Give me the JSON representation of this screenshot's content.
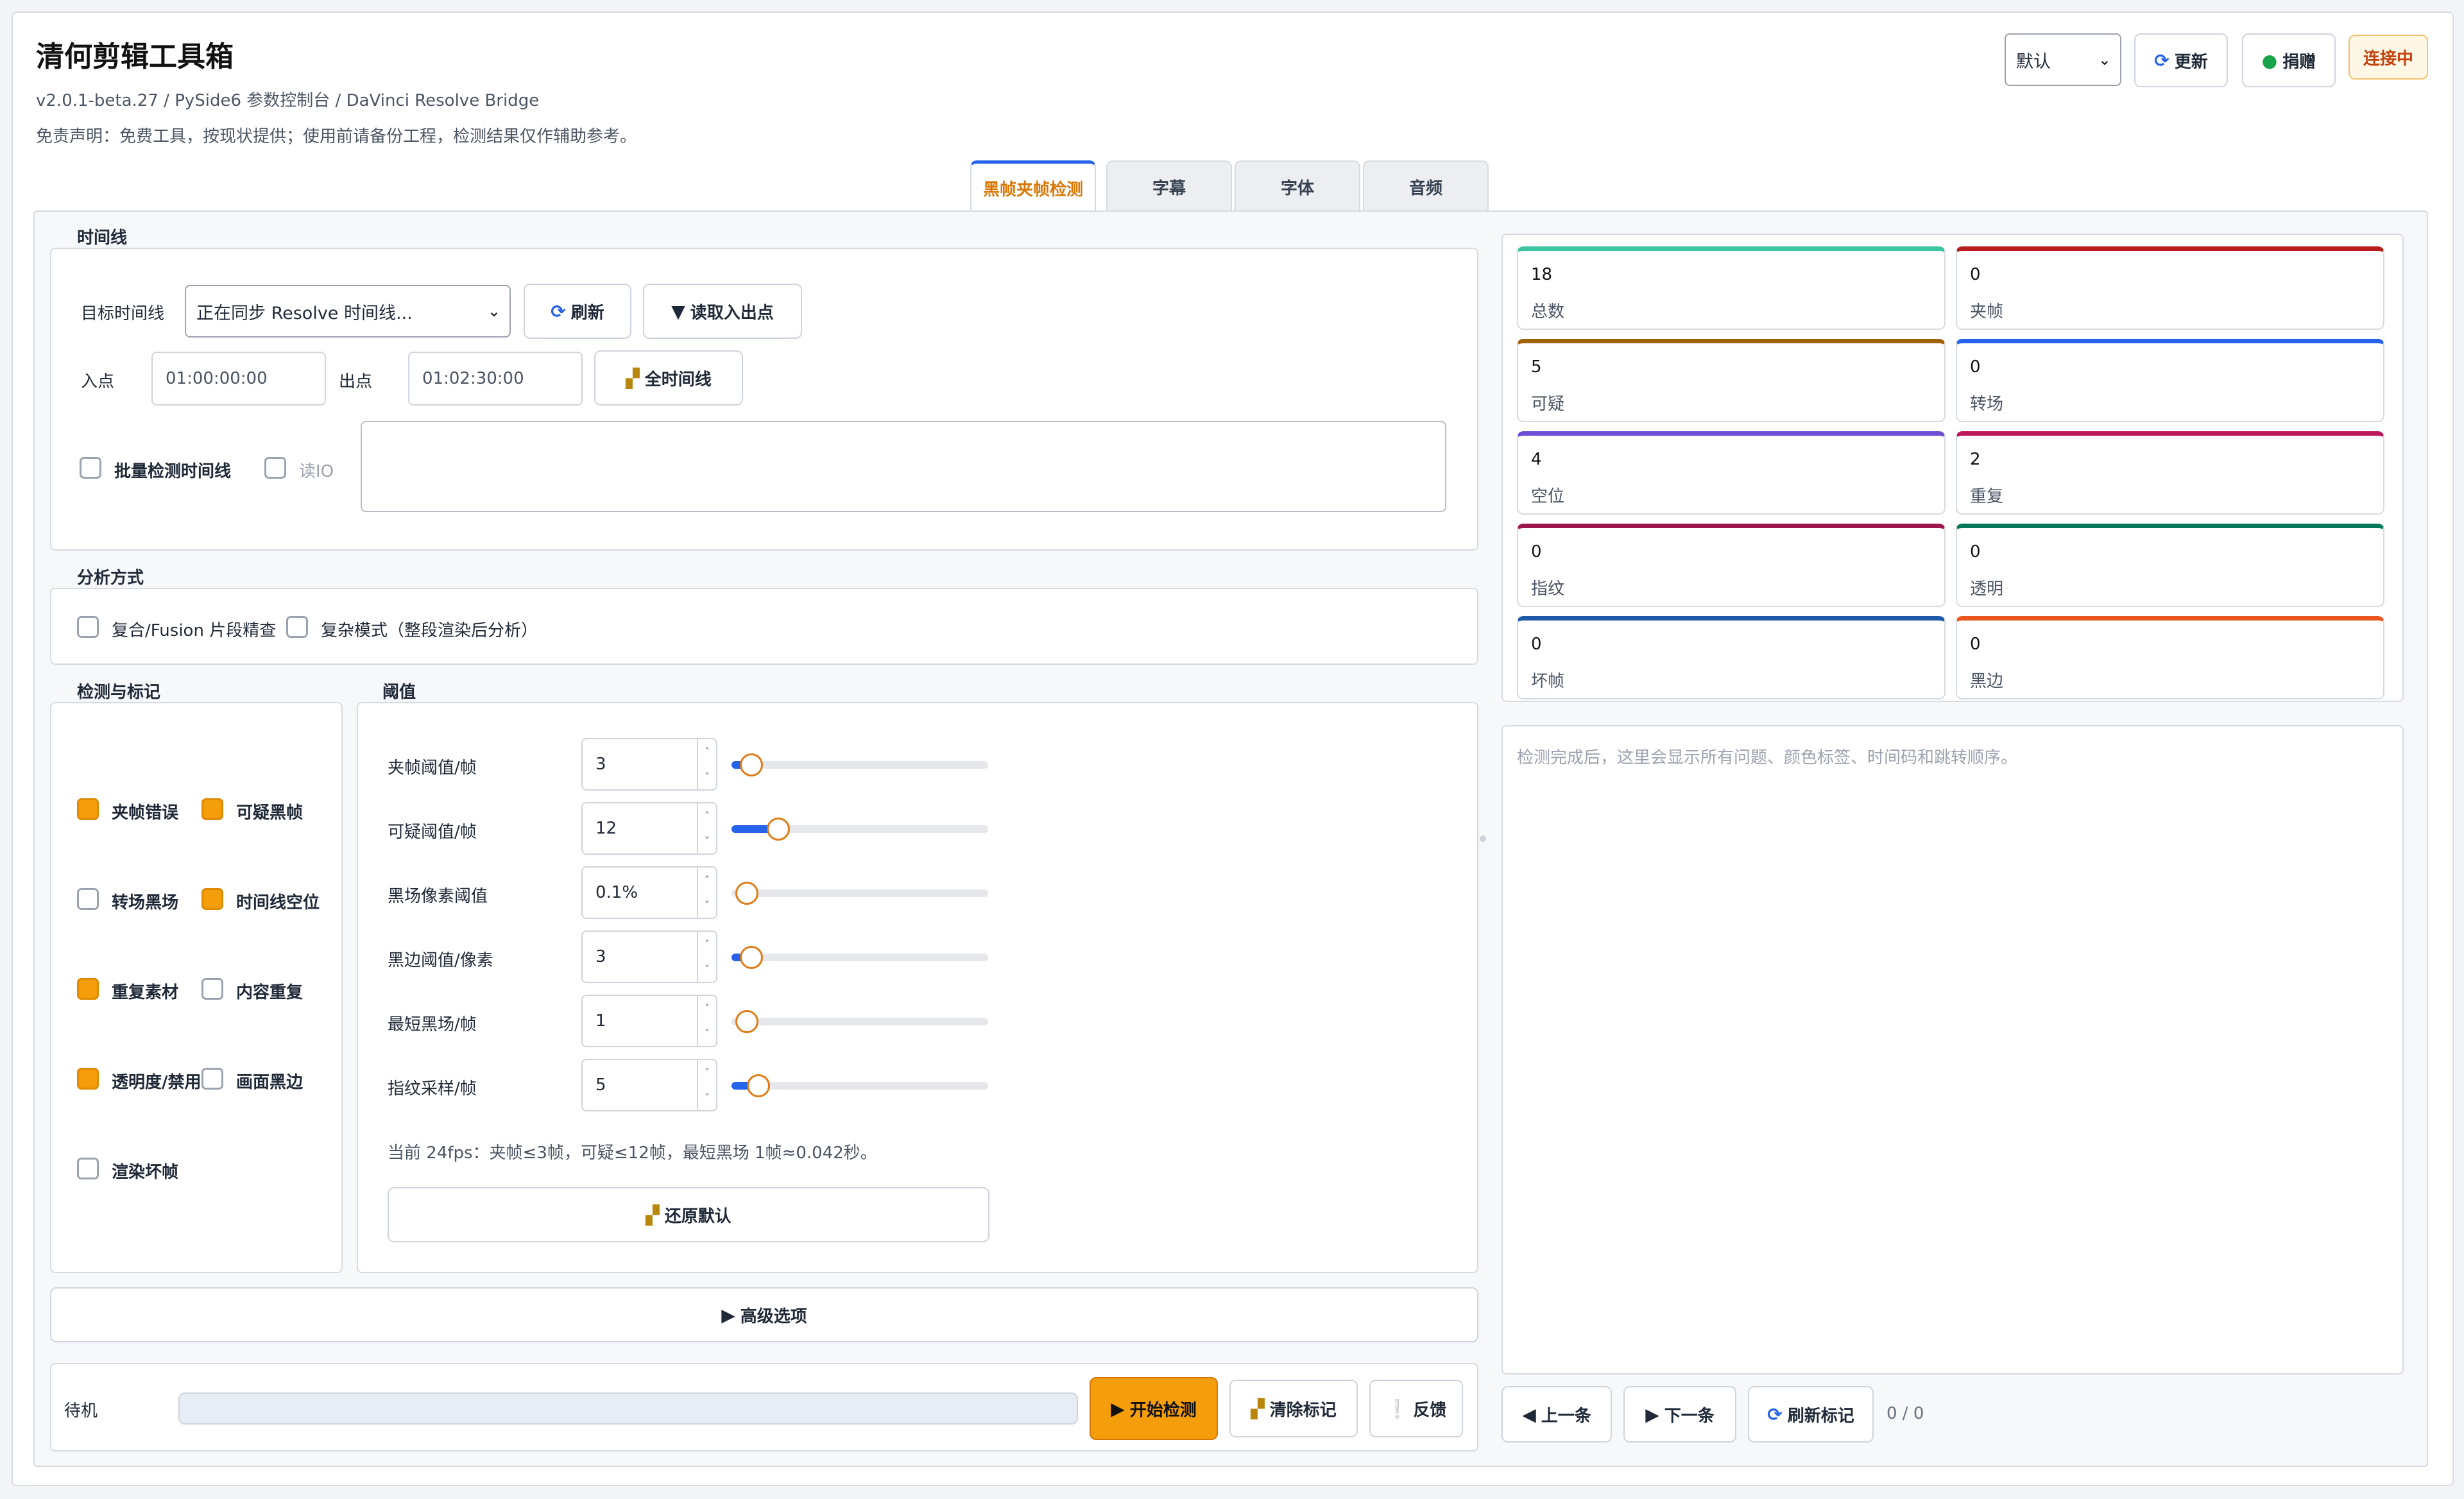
{
  "app": {
    "title": "清何剪辑工具箱",
    "subtitle": "v2.0.1-beta.27 / PySide6 参数控制台 / DaVinci Resolve Bridge",
    "disclaimer": "免责声明：免费工具，按现状提供；使用前请备份工程，检测结果仅作辅助参考。"
  },
  "header": {
    "preset_value": "默认",
    "update_label": "更新",
    "donate_label": "捐赠",
    "status_label": "连接中"
  },
  "tabs": [
    "黑帧夹帧检测",
    "字幕",
    "字体",
    "音频"
  ],
  "timeline": {
    "section_label": "时间线",
    "target_label": "目标时间线",
    "target_value": "正在同步 Resolve 时间线...",
    "refresh_label": "刷新",
    "read_io_label": "读取入出点",
    "in_label": "入点",
    "in_placeholder": "01:00:00:00",
    "out_label": "出点",
    "out_placeholder": "01:02:30:00",
    "full_label": "全时间线",
    "batch_label": "批量检测时间线",
    "read_io_check_label": "读IO"
  },
  "analysis": {
    "section_label": "分析方式",
    "compound_label": "复合/Fusion 片段精查",
    "complex_label": "复杂模式（整段渲染后分析）"
  },
  "detect": {
    "section_label": "检测与标记",
    "items": [
      {
        "label": "夹帧错误",
        "checked": true
      },
      {
        "label": "可疑黑帧",
        "checked": true
      },
      {
        "label": "转场黑场",
        "checked": false
      },
      {
        "label": "时间线空位",
        "checked": true
      },
      {
        "label": "重复素材",
        "checked": true
      },
      {
        "label": "内容重复",
        "checked": false
      },
      {
        "label": "透明度/禁用",
        "checked": true
      },
      {
        "label": "画面黑边",
        "checked": false
      },
      {
        "label": "渲染坏帧",
        "checked": false
      }
    ]
  },
  "threshold": {
    "section_label": "阈值",
    "rows": [
      {
        "label": "夹帧阈值/帧",
        "value": "3",
        "level": 0.02
      },
      {
        "label": "可疑阈值/帧",
        "value": "12",
        "level": 0.14
      },
      {
        "label": "黑场像素阈值",
        "value": "0.1%",
        "level": 0.0
      },
      {
        "label": "黑边阈值/像素",
        "value": "3",
        "level": 0.02
      },
      {
        "label": "最短黑场/帧",
        "value": "1",
        "level": 0.0
      },
      {
        "label": "指纹采样/帧",
        "value": "5",
        "level": 0.05
      }
    ],
    "note": "当前 24fps：夹帧≤3帧，可疑≤12帧，最短黑场 1帧≈0.042秒。",
    "reset_label": "还原默认"
  },
  "advanced_label": "高级选项",
  "footer": {
    "status": "待机",
    "progress": 0,
    "start_label": "开始检测",
    "clear_label": "清除标记",
    "feedback_label": "反馈"
  },
  "stats": [
    {
      "value": "18",
      "label": "总数",
      "color": "#3cc4a0"
    },
    {
      "value": "0",
      "label": "夹帧",
      "color": "#b91c1c"
    },
    {
      "value": "5",
      "label": "可疑",
      "color": "#a16207"
    },
    {
      "value": "0",
      "label": "转场",
      "color": "#2563eb"
    },
    {
      "value": "4",
      "label": "空位",
      "color": "#6d4fd6"
    },
    {
      "value": "2",
      "label": "重复",
      "color": "#be185d"
    },
    {
      "value": "0",
      "label": "指纹",
      "color": "#9d174d"
    },
    {
      "value": "0",
      "label": "透明",
      "color": "#047857"
    },
    {
      "value": "0",
      "label": "坏帧",
      "color": "#1e5aa8"
    },
    {
      "value": "0",
      "label": "黑边",
      "color": "#e8551e"
    }
  ],
  "results": {
    "placeholder": "检测完成后，这里会显示所有问题、颜色标签、时间码和跳转顺序。",
    "prev_label": "上一条",
    "next_label": "下一条",
    "refresh_label": "刷新标记",
    "counter": "0 / 0"
  }
}
